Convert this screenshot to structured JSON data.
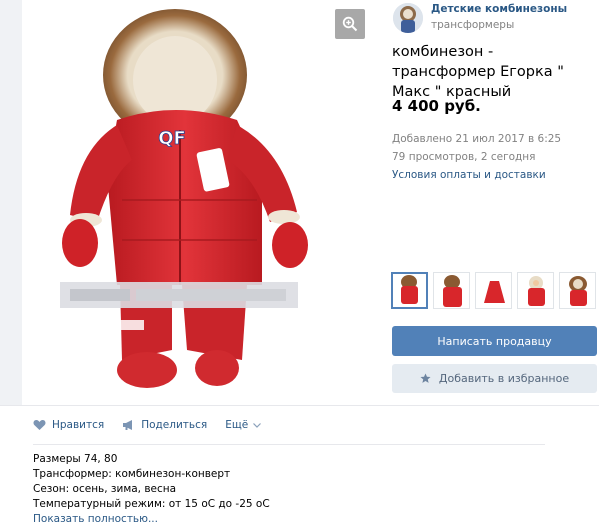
{
  "seller": {
    "name": "Детские комбинезоны",
    "subtitle": "трансформеры"
  },
  "item": {
    "title": "комбинезон - трансформер Егорка \" Макс \" красный",
    "price": "4 400 руб.",
    "added": "Добавлено 21 июл 2017 в 6:25",
    "views": "79 просмотров, 2 сегодня",
    "terms_link": "Условия оплаты и доставки",
    "photo_logo": "QF"
  },
  "buttons": {
    "contact_seller": "Написать продавцу",
    "add_favorite": "Добавить в избранное"
  },
  "thumbnails_count": 5,
  "actions": {
    "like": "Нравится",
    "share": "Поделиться",
    "more": "Ещё"
  },
  "description": {
    "lines": [
      "Размеры 74, 80",
      "Трансформер: комбинезон-конверт",
      "Сезон: осень, зима, весна",
      "Температурный режим: от 15 оС до -25 оС"
    ],
    "show_more": "Показать полностью..."
  },
  "colors": {
    "link": "#2a5885",
    "button_primary": "#5181b8",
    "button_secondary": "#e5ebf1",
    "product_red": "#d8262b",
    "fur": "#8a5a32"
  }
}
